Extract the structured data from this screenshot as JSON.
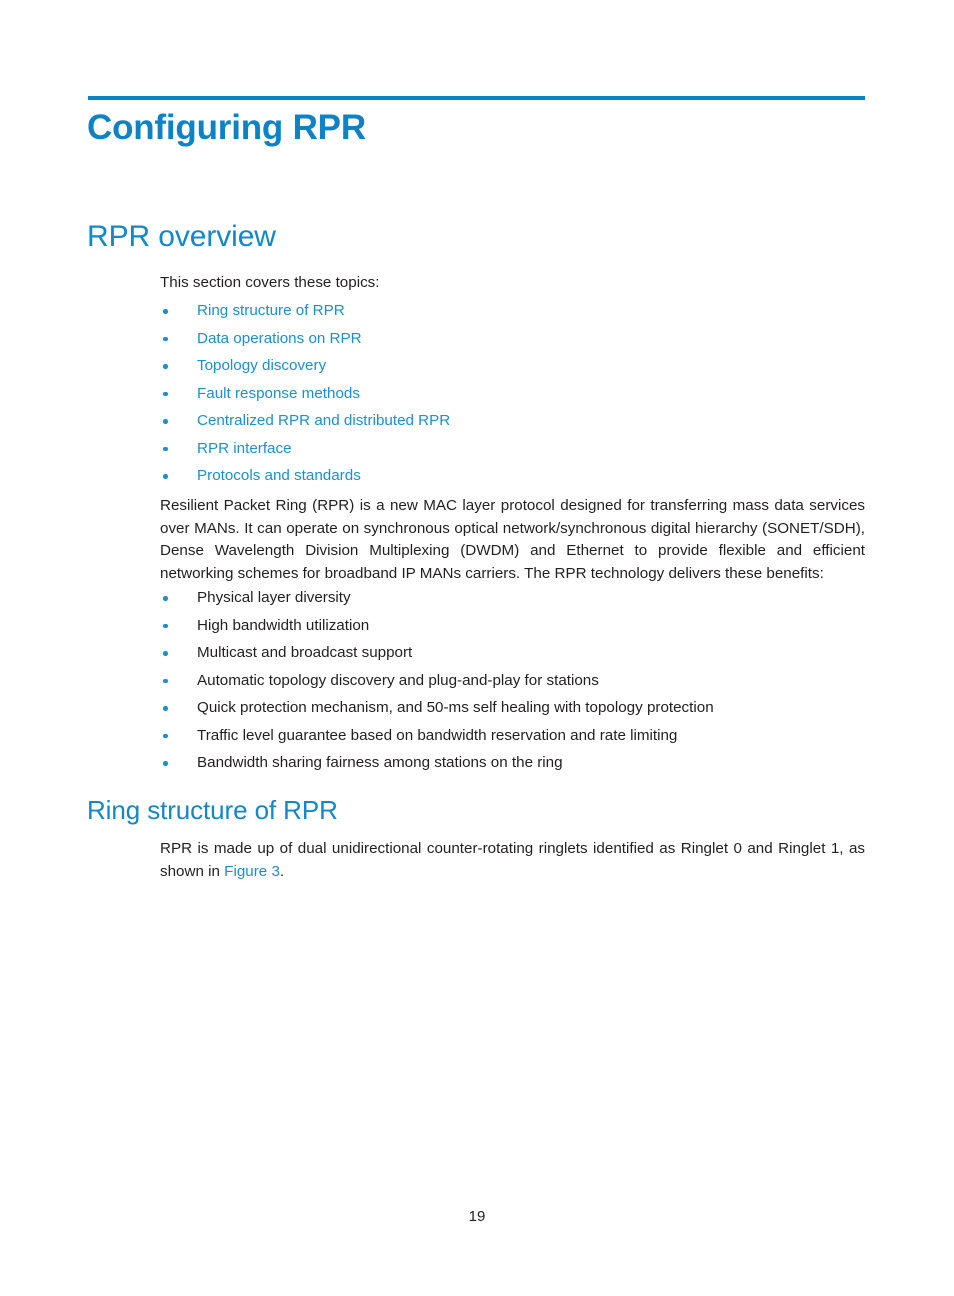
{
  "document": {
    "chapter_title": "Configuring RPR",
    "page_number": "19"
  },
  "colors": {
    "heading_blue": "#1287c9",
    "title_blue": "#0d82c5",
    "rule_blue": "#0c82c4",
    "link_blue": "#1b8fd0",
    "body_black": "#231f20"
  },
  "sections": {
    "overview": {
      "heading": "RPR overview",
      "intro_line": "This section covers these topics:",
      "topics": [
        {
          "label": "Ring structure of RPR"
        },
        {
          "label": "Data operations on RPR"
        },
        {
          "label": "Topology discovery"
        },
        {
          "label": "Fault response methods"
        },
        {
          "label": "Centralized RPR and distributed RPR"
        },
        {
          "label": "RPR interface"
        },
        {
          "label": "Protocols and standards"
        }
      ],
      "paragraph": "Resilient Packet Ring (RPR) is a new MAC layer protocol designed for transferring mass data services over MANs. It can operate on synchronous optical network/synchronous digital hierarchy (SONET/SDH), Dense Wavelength Division Multiplexing (DWDM) and Ethernet to provide flexible and efficient networking schemes for broadband IP MANs carriers. The RPR technology delivers these benefits:",
      "benefits": [
        {
          "label": "Physical layer diversity"
        },
        {
          "label": "High bandwidth utilization"
        },
        {
          "label": "Multicast and broadcast support"
        },
        {
          "label": "Automatic topology discovery and plug-and-play for stations"
        },
        {
          "label": "Quick protection mechanism, and 50-ms self healing with topology protection"
        },
        {
          "label": "Traffic level guarantee based on bandwidth reservation and rate limiting"
        },
        {
          "label": "Bandwidth sharing fairness among stations on the ring"
        }
      ]
    },
    "ring_structure": {
      "heading": "Ring structure of RPR",
      "paragraph_before_link": "RPR is made up of dual unidirectional counter-rotating ringlets identified as Ringlet 0 and Ringlet 1, as shown in ",
      "figure_link": "Figure 3",
      "paragraph_after_link": "."
    }
  }
}
